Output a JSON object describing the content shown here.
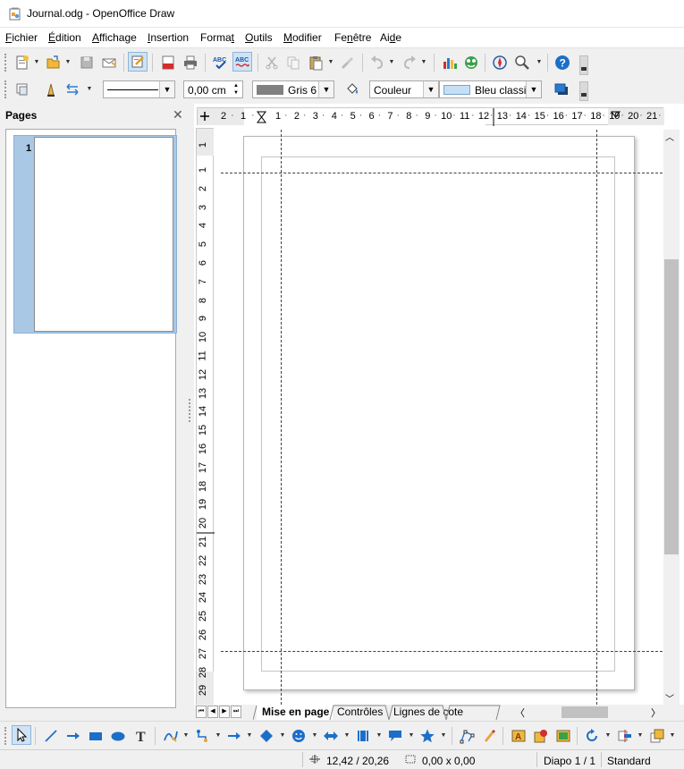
{
  "window": {
    "title": "Journal.odg - OpenOffice Draw"
  },
  "menu": [
    {
      "label": "Fichier"
    },
    {
      "label": "Édition"
    },
    {
      "label": "Affichage"
    },
    {
      "label": "Insertion"
    },
    {
      "label": "Format"
    },
    {
      "label": "Outils"
    },
    {
      "label": "Modifier"
    },
    {
      "label": "Fenêtre"
    },
    {
      "label": "Aide"
    }
  ],
  "line_toolbar": {
    "line_width": "0,00 cm",
    "line_color": "Gris 6",
    "line_color_hex": "#808080",
    "area_style": "Couleur",
    "area_color": "Bleu classique",
    "area_color_hex": "#c5dff5"
  },
  "pages_panel": {
    "title": "Pages",
    "close_glyph": "✕",
    "pages": [
      {
        "number": "1"
      }
    ]
  },
  "rulers": {
    "horizontal": [
      "2",
      "1",
      "1",
      "2",
      "3",
      "4",
      "5",
      "6",
      "7",
      "8",
      "9",
      "10",
      "11",
      "12",
      "13",
      "14",
      "15",
      "16",
      "17",
      "18",
      "19",
      "20",
      "21"
    ],
    "vertical": [
      "1",
      "1",
      "2",
      "3",
      "4",
      "5",
      "6",
      "7",
      "8",
      "9",
      "10",
      "11",
      "12",
      "13",
      "14",
      "15",
      "16",
      "17",
      "18",
      "19",
      "20",
      "21",
      "22",
      "23",
      "24",
      "25",
      "26",
      "27",
      "28",
      "29"
    ]
  },
  "sheet_tabs": [
    {
      "label": "Mise en page"
    },
    {
      "label": "Contrôles"
    },
    {
      "label": "Lignes de cote"
    }
  ],
  "status": {
    "position": "12,42 / 20,26",
    "size": "0,00 x 0,00",
    "slide": "Diapo 1 / 1",
    "layout": "Standard"
  },
  "colors": {
    "selection": "#a8c8e6",
    "accent_blue": "#1c6fc8"
  }
}
